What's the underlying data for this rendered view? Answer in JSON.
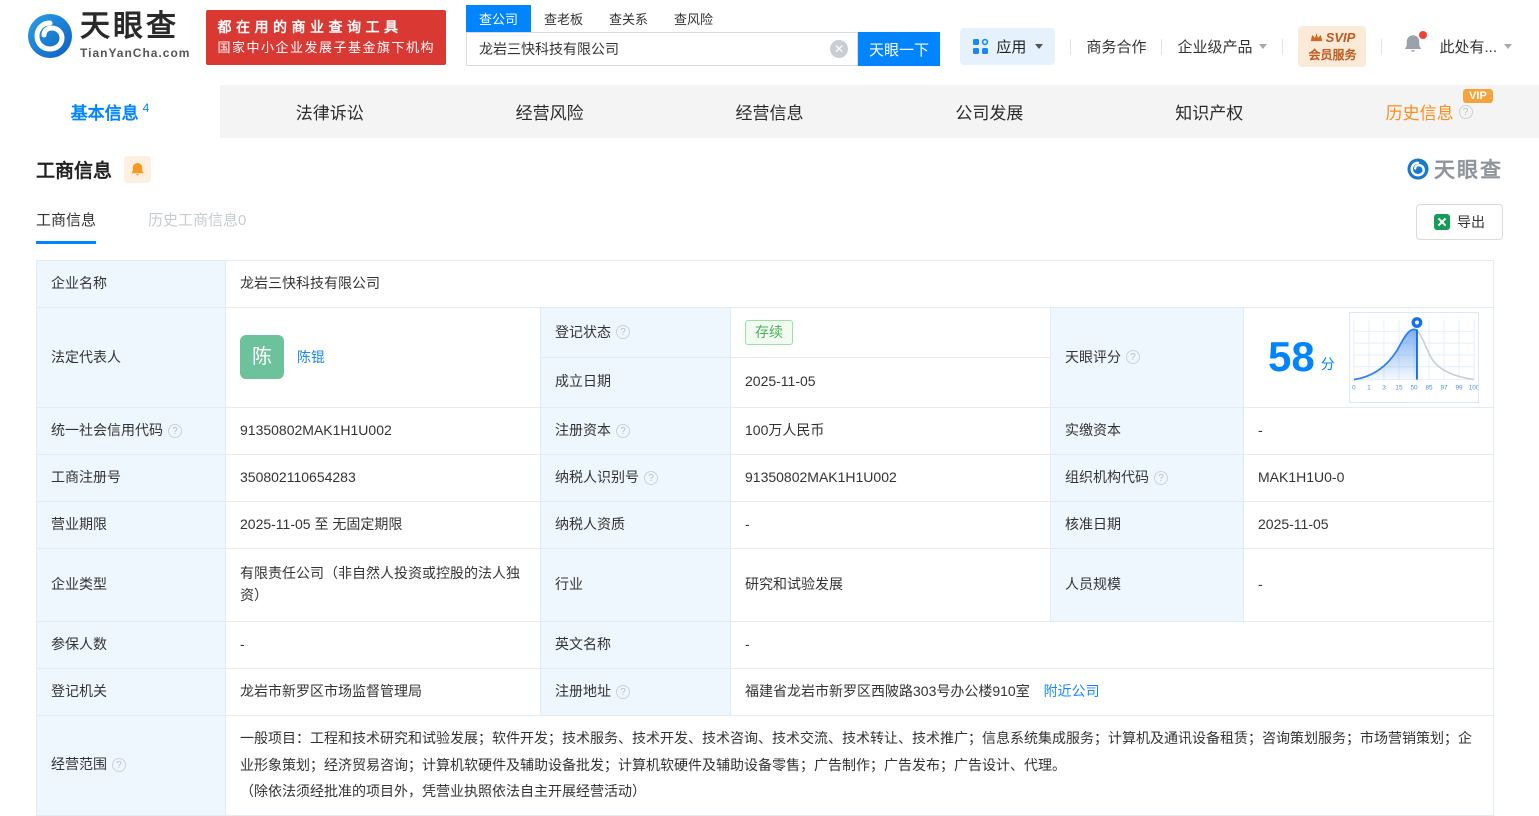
{
  "colors": {
    "accent": "#0084ff",
    "brand_red": "#da3832",
    "vip_orange": "#ff8c19",
    "status_green": "#4bb157"
  },
  "brand": {
    "name": "天眼查",
    "domain": "TianYanCha.com",
    "slogan1": "都在用的商业查询工具",
    "slogan2": "国家中小企业发展子基金旗下机构"
  },
  "search": {
    "tabs": [
      "查公司",
      "查老板",
      "查关系",
      "查风险"
    ],
    "value": "龙岩三快科技有限公司",
    "button": "天眼一下"
  },
  "topmenu": {
    "apps": "应用",
    "biz": "商务合作",
    "enterprise": "企业级产品",
    "svip1": "SVIP",
    "svip2": "会员服务",
    "more": "此处有..."
  },
  "nav": {
    "tabs": [
      {
        "label": "基本信息",
        "count": "4"
      },
      {
        "label": "法律诉讼"
      },
      {
        "label": "经营风险"
      },
      {
        "label": "经营信息"
      },
      {
        "label": "公司发展"
      },
      {
        "label": "知识产权"
      },
      {
        "label": "历史信息",
        "badge": "VIP"
      }
    ]
  },
  "section": {
    "title": "工商信息",
    "tab_current": "工商信息",
    "tab_history": "历史工商信息0",
    "export": "导出",
    "watermark": "天眼查"
  },
  "info": {
    "company_name": {
      "label": "企业名称",
      "value": "龙岩三快科技有限公司"
    },
    "legal_rep": {
      "label": "法定代表人",
      "avatar": "陈",
      "name": "陈锟"
    },
    "reg_status": {
      "label": "登记状态",
      "value": "存续"
    },
    "establish_date": {
      "label": "成立日期",
      "value": "2025-11-05"
    },
    "score": {
      "label": "天眼评分",
      "value": "58",
      "unit": "分"
    },
    "credit_code": {
      "label": "统一社会信用代码",
      "value": "91350802MAK1H1U002"
    },
    "reg_capital": {
      "label": "注册资本",
      "value": "100万人民币"
    },
    "paid_capital": {
      "label": "实缴资本",
      "value": "-"
    },
    "reg_no": {
      "label": "工商注册号",
      "value": "350802110654283"
    },
    "taxpayer_no": {
      "label": "纳税人识别号",
      "value": "91350802MAK1H1U002"
    },
    "org_code": {
      "label": "组织机构代码",
      "value": "MAK1H1U0-0"
    },
    "term": {
      "label": "营业期限",
      "value": "2025-11-05 至 无固定期限"
    },
    "taxpayer_quality": {
      "label": "纳税人资质",
      "value": "-"
    },
    "approve_date": {
      "label": "核准日期",
      "value": "2025-11-05"
    },
    "company_type": {
      "label": "企业类型",
      "value": "有限责任公司（非自然人投资或控股的法人独资）"
    },
    "industry": {
      "label": "行业",
      "value": "研究和试验发展"
    },
    "staff_scale": {
      "label": "人员规模",
      "value": "-"
    },
    "insured_num": {
      "label": "参保人数",
      "value": "-"
    },
    "english_name": {
      "label": "英文名称",
      "value": "-"
    },
    "reg_org": {
      "label": "登记机关",
      "value": "龙岩市新罗区市场监督管理局"
    },
    "address": {
      "label": "注册地址",
      "value": "福建省龙岩市新罗区西陂路303号办公楼910室",
      "link": "附近公司"
    },
    "scope": {
      "label": "经营范围",
      "value": "一般项目：工程和技术研究和试验发展；软件开发；技术服务、技术开发、技术咨询、技术交流、技术转让、技术推广；信息系统集成服务；计算机及通讯设备租赁；咨询策划服务；市场营销策划；企业形象策划；经济贸易咨询；计算机软硬件及辅助设备批发；计算机软硬件及辅助设备零售；广告制作；广告发布；广告设计、代理。",
      "note": "（除依法须经批准的项目外，凭营业执照依法自主开展经营活动）"
    }
  },
  "chart_data": {
    "type": "area",
    "title": "天眼评分 score distribution curve",
    "x_ticks": [
      "0",
      "1",
      "3",
      "15",
      "50",
      "85",
      "97",
      "99",
      "100"
    ],
    "score": 58,
    "legend_position": "none",
    "grid": true
  }
}
